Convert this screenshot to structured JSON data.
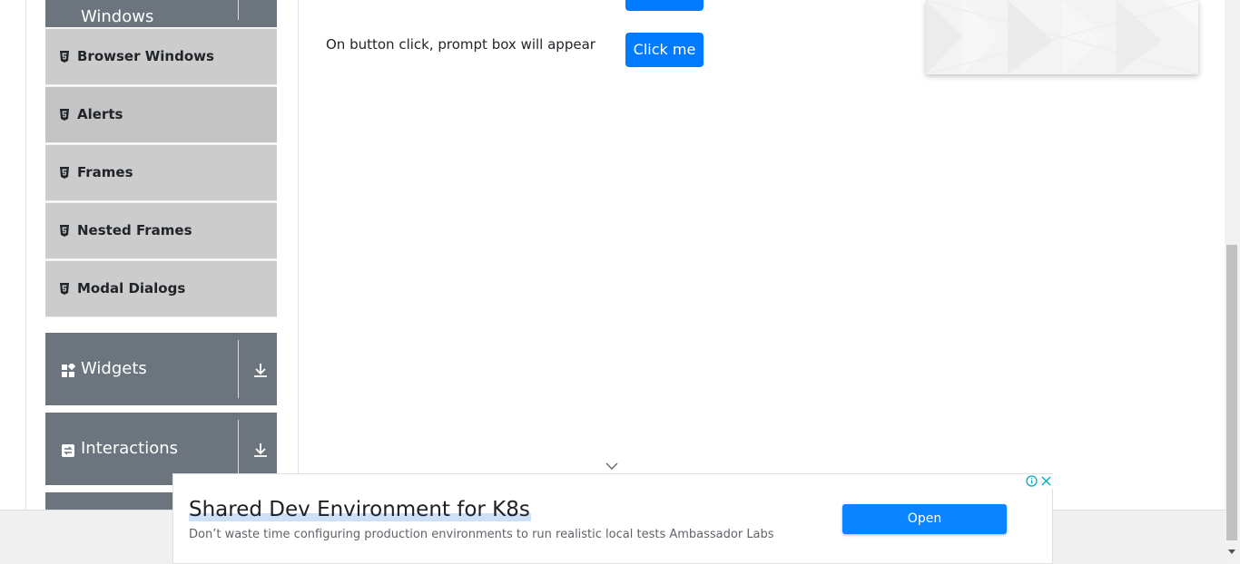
{
  "sidebar": {
    "groups": {
      "alerts_frames_windows": {
        "label": "Windows"
      },
      "widgets": {
        "label": "Widgets"
      },
      "interactions": {
        "label": "Interactions"
      }
    },
    "items": [
      {
        "label": "Browser Windows"
      },
      {
        "label": "Alerts"
      },
      {
        "label": "Frames"
      },
      {
        "label": "Nested Frames"
      },
      {
        "label": "Modal Dialogs"
      }
    ]
  },
  "main": {
    "prompt_row": {
      "text": "On button click, prompt box will appear",
      "button_label": "Click me"
    }
  },
  "ad": {
    "title": "Shared Dev Environment for K8s",
    "description": "Don’t waste time configuring production environments to run realistic local tests Ambassador Labs",
    "open_label": "Open"
  },
  "colors": {
    "primary": "#007bff",
    "sidebar_header": "#6c757d",
    "sidebar_item": "#cccccc"
  }
}
